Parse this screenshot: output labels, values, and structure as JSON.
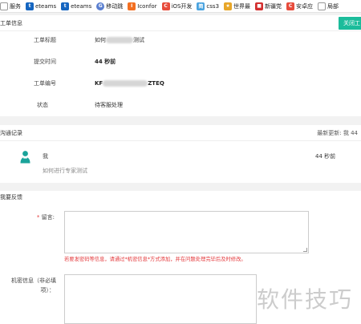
{
  "bookmarks": [
    {
      "label": "服务",
      "icon": "bookmark-icon",
      "glyph": "",
      "color": "#ffffff",
      "style": "outline"
    },
    {
      "label": "eteams",
      "icon": "eteams-icon",
      "glyph": "t",
      "color": "#1565c0",
      "style": "square"
    },
    {
      "label": "eteams",
      "icon": "eteams-icon",
      "glyph": "t",
      "color": "#1565c0",
      "style": "square"
    },
    {
      "label": "移动跳",
      "icon": "blue-globe-icon",
      "glyph": "G",
      "color": "#5a7fd0",
      "style": "round"
    },
    {
      "label": "Iconfor",
      "icon": "iconfont-icon",
      "glyph": "I",
      "color": "#f36f21",
      "style": "square"
    },
    {
      "label": "iOS开发",
      "icon": "csdn-icon",
      "glyph": "C",
      "color": "#e74c3c",
      "style": "square"
    },
    {
      "label": "css3",
      "icon": "css-icon",
      "glyph": "简",
      "color": "#4aa3df",
      "style": "square"
    },
    {
      "label": "世界最",
      "icon": "flame-icon",
      "glyph": "★",
      "color": "#e8a628",
      "style": "square"
    },
    {
      "label": "新疆党",
      "icon": "flag-icon",
      "glyph": "■",
      "color": "#d32f2f",
      "style": "square"
    },
    {
      "label": "安卓应",
      "icon": "csdn-icon",
      "glyph": "C",
      "color": "#e74c3c",
      "style": "square"
    },
    {
      "label": "局部",
      "icon": "page-icon",
      "glyph": "",
      "color": "#ffffff",
      "style": "outline"
    }
  ],
  "ticket": {
    "section_title": "工单信息",
    "close_button": "关闭工",
    "fields": [
      {
        "label": "工单标题",
        "value_prefix": "如何",
        "value_suffix": "测试",
        "bold": false
      },
      {
        "label": "提交时间",
        "value_prefix": "44 秒前",
        "value_suffix": "",
        "bold": true
      },
      {
        "label": "工单编号",
        "value_prefix": "KF",
        "value_suffix": "ZTEQ",
        "bold": true
      },
      {
        "label": "状态",
        "value_prefix": "待客服处理",
        "value_suffix": "",
        "bold": false
      }
    ]
  },
  "communication": {
    "section_title": "沟通记录",
    "latest_update": "最新更新: 我 44",
    "message": {
      "sender": "我",
      "text": "如何进行专家测试",
      "time": "44 秒前"
    }
  },
  "feedback": {
    "section_title": "我要反馈",
    "message_label": "留言:",
    "required_mark": "*",
    "warning": "若要发密码等信息，请通过*机密信息*方式添加，并在问题处理完毕后及时修改。",
    "secret_label_1": "机密信息（非必填",
    "secret_label_2": "项）："
  },
  "watermark": "软件技巧",
  "colors": {
    "accent": "#1bbc9b",
    "warning": "#e4393c",
    "avatar": "#1aa39a"
  }
}
